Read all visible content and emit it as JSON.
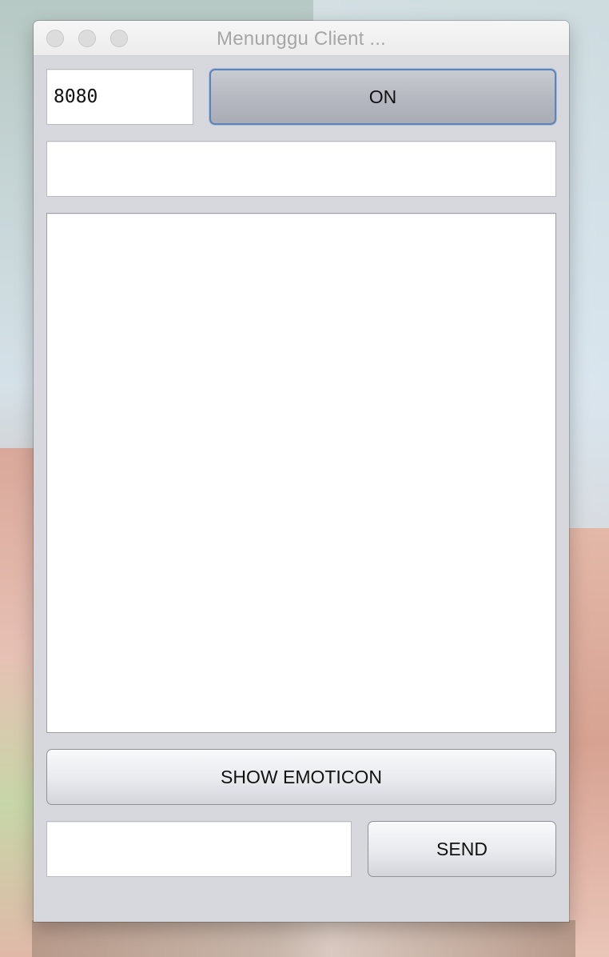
{
  "window": {
    "title": "Menunggu Client ..."
  },
  "controls": {
    "port_value": "8080",
    "on_label": "ON",
    "ip_value": "",
    "chat_text": "",
    "show_emoticon_label": "SHOW EMOTICON",
    "message_value": "",
    "send_label": "SEND"
  },
  "colors": {
    "window_bg": "#d6d8de",
    "focus_ring": "#5d84b8",
    "title_text": "#a6a6a6"
  }
}
